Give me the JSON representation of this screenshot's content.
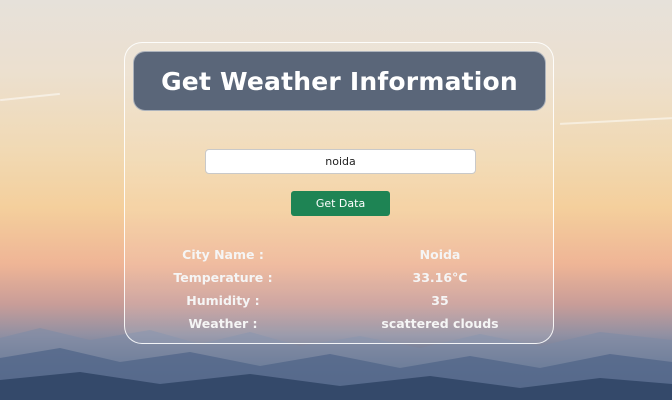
{
  "page": {
    "title": "Get Weather Information"
  },
  "search": {
    "value": "noida",
    "button_label": "Get Data"
  },
  "weather": {
    "rows": [
      {
        "label": "City Name :",
        "value": "Noida"
      },
      {
        "label": "Temperature :",
        "value": "33.16°C"
      },
      {
        "label": "Humidity :",
        "value": "35"
      },
      {
        "label": "Weather :",
        "value": "scattered clouds"
      }
    ]
  },
  "colors": {
    "header_bg": "#5a6679",
    "button_bg": "#1e8454",
    "text": "#f5f5f5"
  }
}
